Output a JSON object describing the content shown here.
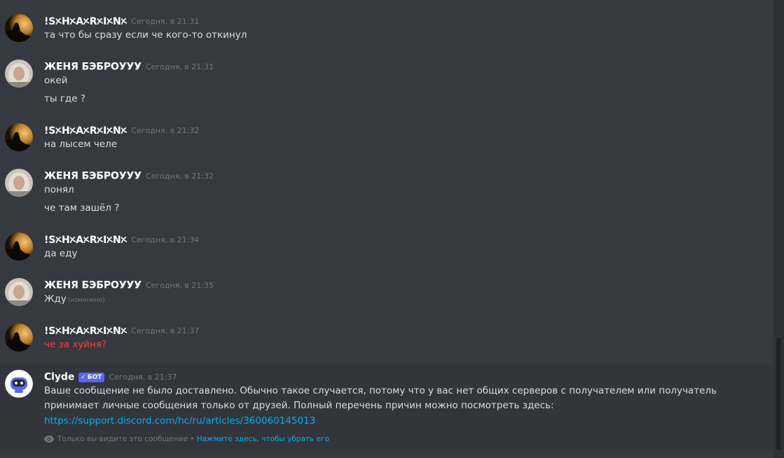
{
  "users": {
    "sharing": {
      "name": "!SᝣHᝣAᝣRᝣIᝣNᝣ",
      "avatar_icon": "silhouette-sunset-avatar"
    },
    "zhenya": {
      "name": "ЖЕНЯ БЭБРОУУУ",
      "avatar_icon": "girl-photo-avatar"
    }
  },
  "messages": [
    {
      "author": "!SᝣHᝣAᝣRᝣIᝣNᝣ",
      "time": "Сегодня, в 21:31",
      "lines": [
        "та что бы сразу если че кого-то откинул"
      ]
    },
    {
      "author": "ЖЕНЯ БЭБРОУУУ",
      "time": "Сегодня, в 21:31",
      "lines": [
        "окей",
        "ты где ?"
      ]
    },
    {
      "author": "!SᝣHᝣAᝣRᝣIᝣNᝣ",
      "time": "Сегодня, в 21:32",
      "lines": [
        "на лысем челе"
      ]
    },
    {
      "author": "ЖЕНЯ БЭБРОУУУ",
      "time": "Сегодня, в 21:32",
      "lines": [
        "понял",
        "че там зашёл ?"
      ]
    },
    {
      "author": "!SᝣHᝣAᝣRᝣIᝣNᝣ",
      "time": "Сегодня, в 21:34",
      "lines": [
        "да еду"
      ]
    },
    {
      "author": "ЖЕНЯ БЭБРОУУУ",
      "time": "Сегодня, в 21:35",
      "lines": [
        "Жду"
      ],
      "edited": "(изменено)"
    },
    {
      "author": "!SᝣHᝣAᝣRᝣIᝣNᝣ",
      "time": "Сегодня, в 21:37",
      "lines": [
        "че за хуйня?"
      ],
      "failed": true
    }
  ],
  "clyde": {
    "author": "Clyde",
    "badge": "БОТ",
    "badge_check": "✓",
    "time": "Сегодня, в 21:37",
    "text_line1": "Ваше сообщение не было доставлено. Обычно такое случается, потому что у вас нет общих серверов с получателем или получатель",
    "text_line2": "принимает личные сообщения только от друзей. Полный перечень причин можно посмотреть здесь:",
    "link": "https://support.discord.com/hc/ru/articles/360060145013",
    "ephemeral_note": "Только вы видите это сообщение",
    "separator": "•",
    "dismiss": "Нажмите здесь, чтобы убрать его",
    "avatar_icon": "clyde-robot-avatar"
  },
  "colors": {
    "background": "#36393f",
    "text": "#dcddde",
    "timestamp": "#72767d",
    "link": "#00aff4",
    "error": "#ed4245",
    "blurple": "#5865f2"
  }
}
